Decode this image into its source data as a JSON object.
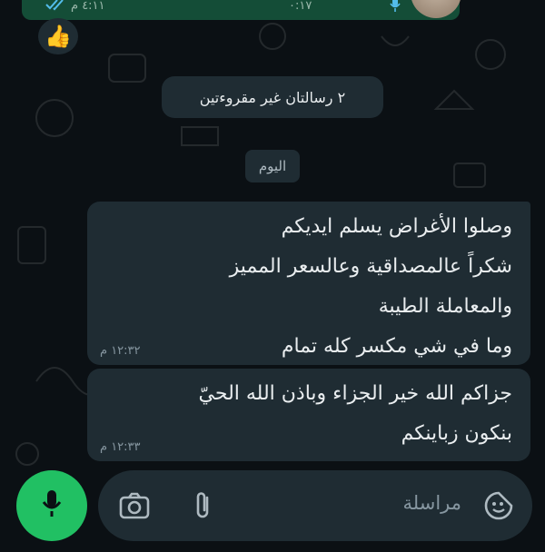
{
  "top_message": {
    "time": "٤:١١ م",
    "duration": "٠:١٧"
  },
  "reaction_emoji": "👍",
  "unread_banner": "٢ رسالتان غير مقروءتين",
  "date_separator": "اليوم",
  "messages": [
    {
      "lines": [
        "وصلوا الأغراض يسلم ايديكم",
        "شكراً عالمصداقية وعالسعر المميز",
        "والمعاملة الطيبة",
        "وما في شي مكسر كله تمام"
      ],
      "time": "١٢:٣٢ م"
    },
    {
      "lines": [
        "جزاكم الله خير الجزاء وباذن الله الحيّ",
        "بنكون زباينكم"
      ],
      "time": "١٢:٣٣ م"
    }
  ],
  "composer": {
    "placeholder": "مراسلة",
    "icons": [
      "emoji-icon",
      "paperclip-icon",
      "camera-icon",
      "microphone-icon"
    ]
  },
  "colors": {
    "background": "#0b1014",
    "bubble_incoming": "#1f2c33",
    "bubble_outgoing": "#144d37",
    "accent_green": "#21c063",
    "meta_text": "#8696a0"
  }
}
